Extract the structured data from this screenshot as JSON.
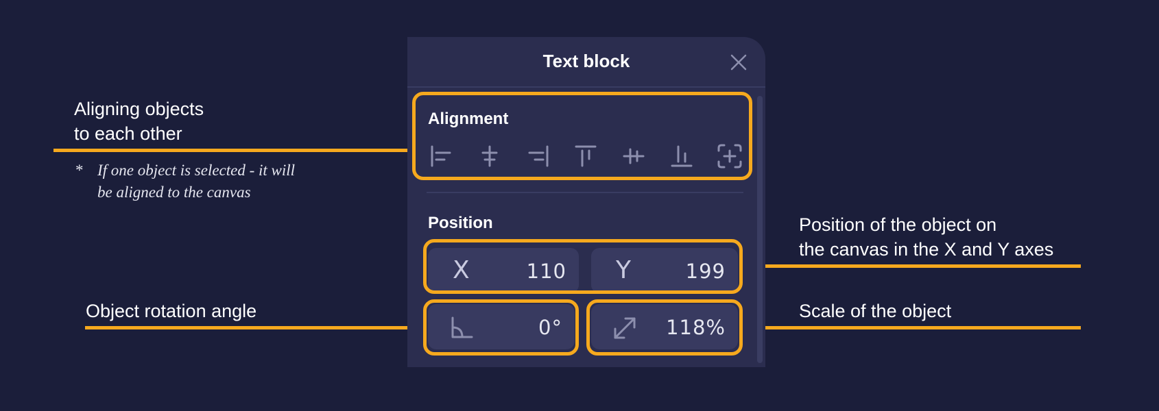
{
  "panel": {
    "title": "Text block",
    "alignment_label": "Alignment",
    "position_label": "Position",
    "x_label": "X",
    "x_value": "110",
    "y_label": "Y",
    "y_value": "199",
    "rotation_value": "0°",
    "scale_value": "118%"
  },
  "annotations": {
    "align_line1": "Aligning objects",
    "align_line2": "to each other",
    "align_note_star": "*",
    "align_note_line1": "If one object is selected - it will",
    "align_note_line2": "be aligned to the canvas",
    "position_line1": "Position of the object on",
    "position_line2": "the canvas in the X and Y axes",
    "rotation": "Object rotation angle",
    "scale": "Scale of the object"
  },
  "icons": {
    "close": "close-icon",
    "align_left": "align-left-icon",
    "align_center_h": "align-center-horizontal-icon",
    "align_right": "align-right-icon",
    "align_top": "align-top-icon",
    "align_middle_v": "align-middle-vertical-icon",
    "align_bottom": "align-bottom-icon",
    "align_canvas": "align-to-canvas-icon",
    "rotation": "rotation-angle-icon",
    "scale": "scale-arrow-icon"
  },
  "colors": {
    "background": "#1b1e3a",
    "panel": "#2b2d4f",
    "field": "#383a60",
    "highlight": "#f6a91e",
    "icon": "#8d8fae"
  }
}
